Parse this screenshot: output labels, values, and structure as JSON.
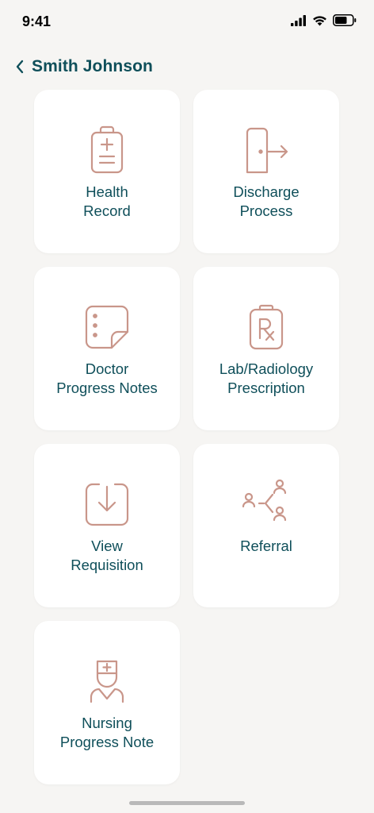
{
  "status_bar": {
    "time": "9:41"
  },
  "header": {
    "title": "Smith Johnson"
  },
  "cards": [
    {
      "line1": "Health",
      "line2": "Record",
      "icon": "clipboard-plus-icon"
    },
    {
      "line1": "Discharge",
      "line2": "Process",
      "icon": "door-exit-icon"
    },
    {
      "line1": "Doctor",
      "line2": "Progress Notes",
      "icon": "sticky-note-icon"
    },
    {
      "line1": "Lab/Radiology",
      "line2": "Prescription",
      "icon": "rx-clipboard-icon"
    },
    {
      "line1": "View",
      "line2": "Requisition",
      "icon": "download-box-icon"
    },
    {
      "line1": "Referral",
      "line2": "",
      "icon": "referral-people-icon"
    },
    {
      "line1": "Nursing",
      "line2": "Progress Note",
      "icon": "nurse-icon"
    }
  ],
  "colors": {
    "accent": "#0f4f5a",
    "icon": "#c9968a",
    "background": "#f6f5f3",
    "card": "#ffffff"
  }
}
